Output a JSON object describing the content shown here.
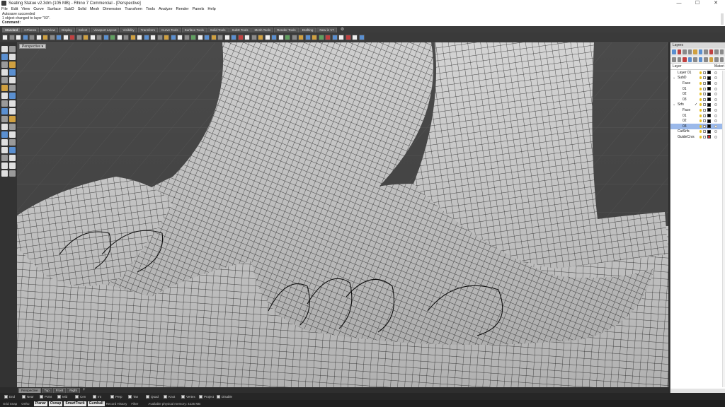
{
  "window": {
    "title": "Seating Statue v2.3dm (105 MB) - Rhino 7 Commercial - [Perspective]",
    "minimize": "—",
    "maximize": "☐",
    "close": "✕"
  },
  "menu": [
    "File",
    "Edit",
    "View",
    "Curve",
    "Surface",
    "SubD",
    "Solid",
    "Mesh",
    "Dimension",
    "Transform",
    "Tools",
    "Analyze",
    "Render",
    "Panels",
    "Help"
  ],
  "command": {
    "history": [
      "Autosave succeeded",
      "1 object changed to layer \"03\"."
    ],
    "prompt": "Command:"
  },
  "tabs": [
    "Standard",
    "CPlanes",
    "Set View",
    "Display",
    "Select",
    "Viewport Layout",
    "Visibility",
    "Transform",
    "Curve Tools",
    "Surface Tools",
    "Solid Tools",
    "SubD Tools",
    "Mesh Tools",
    "Render Tools",
    "Drafting",
    "New in V7"
  ],
  "viewport": {
    "label": "Perspective ▾",
    "tabs": [
      "Perspective",
      "Top",
      "Front",
      "Right"
    ],
    "add_tab": "+"
  },
  "osnaps": [
    "End",
    "Near",
    "Point",
    "Mid",
    "Cen",
    "Int",
    "Perp",
    "Tan",
    "Quad",
    "Knot",
    "Vertex",
    "Project",
    "Disable"
  ],
  "status": {
    "grid_snap": "Grid Snap",
    "ortho": "Ortho",
    "planar": "Planar",
    "osnap": "Osnap",
    "smarttrack": "SmartTrack",
    "gumball": "Gumball",
    "record_history": "Record History",
    "filter": "Filter",
    "memory": "Available physical memory: 4235 MB"
  },
  "layers": {
    "panel_title": "Layers",
    "col_layer": "Layer",
    "col_material": "Materi",
    "rows": [
      {
        "name": "Layer 01",
        "indent": 0,
        "toggle": "",
        "check": "",
        "color": "#000000",
        "selected": false
      },
      {
        "name": "SubD",
        "indent": 0,
        "toggle": "⌄",
        "check": "",
        "color": "#000000",
        "selected": false
      },
      {
        "name": "Face",
        "indent": 1,
        "toggle": "",
        "check": "",
        "color": "#000000",
        "selected": false
      },
      {
        "name": "01",
        "indent": 1,
        "toggle": "",
        "check": "",
        "color": "#000000",
        "selected": false
      },
      {
        "name": "02",
        "indent": 1,
        "toggle": "",
        "check": "",
        "color": "#000000",
        "selected": false
      },
      {
        "name": "03",
        "indent": 1,
        "toggle": "",
        "check": "",
        "color": "#000000",
        "selected": false
      },
      {
        "name": "Srfs",
        "indent": 0,
        "toggle": "⌄",
        "check": "✓",
        "color": "#000000",
        "selected": false
      },
      {
        "name": "Face",
        "indent": 1,
        "toggle": "",
        "check": "",
        "color": "#000000",
        "selected": false
      },
      {
        "name": "01",
        "indent": 1,
        "toggle": "",
        "check": "",
        "color": "#000000",
        "selected": false
      },
      {
        "name": "02",
        "indent": 1,
        "toggle": "",
        "check": "",
        "color": "#000000",
        "selected": false
      },
      {
        "name": "03",
        "indent": 1,
        "toggle": "",
        "check": "",
        "color": "#000000",
        "selected": true
      },
      {
        "name": "CutSrfs",
        "indent": 0,
        "toggle": "",
        "check": "",
        "color": "#000000",
        "selected": false
      },
      {
        "name": "GuideCrvs",
        "indent": 0,
        "toggle": "",
        "check": "",
        "color": "#d03030",
        "selected": false
      }
    ]
  },
  "colors": {
    "viewport_bg": "#4a4a4a",
    "selected_row": "#9bb9ea",
    "mesh": "#d4d4d4",
    "wire": "#1a1a1a"
  }
}
